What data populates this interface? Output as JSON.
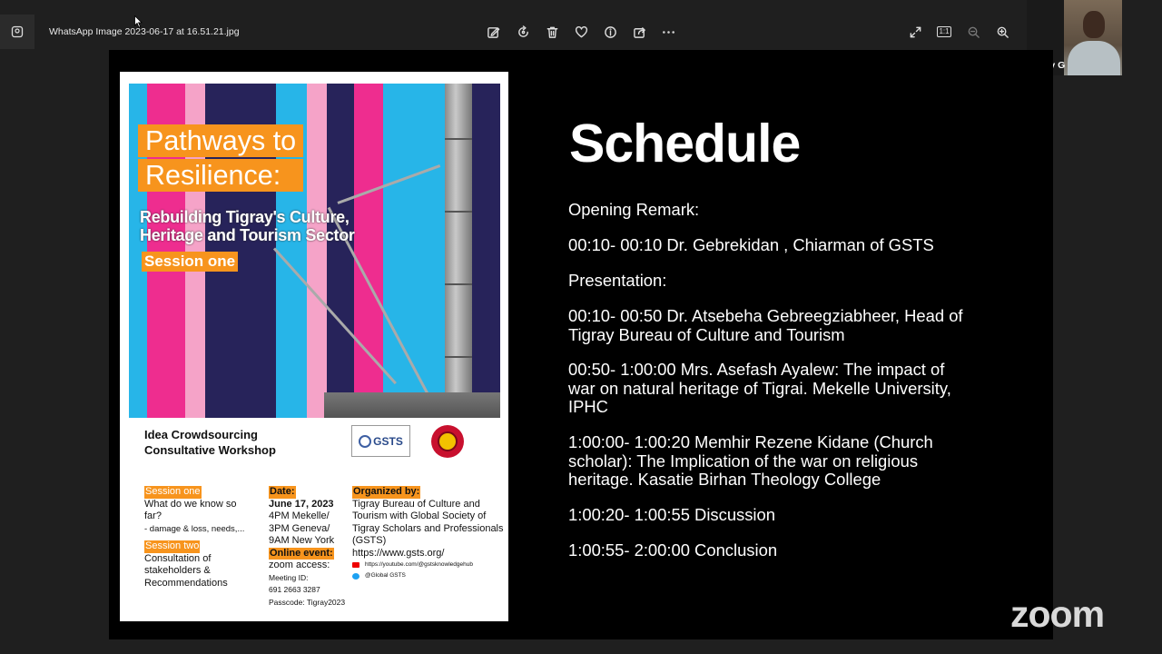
{
  "window": {
    "title": "WhatsApp Image 2023-06-17 at 16.51.21.jpg",
    "toolbar": [
      "edit-image-icon",
      "rotate-icon",
      "delete-icon",
      "favorite-icon",
      "info-icon",
      "share-icon",
      "more-icon"
    ],
    "right_tools": [
      "fullscreen-icon",
      "actual-size-icon",
      "zoom-out-icon",
      "zoom-in-icon"
    ],
    "actual_size_label": "1:1"
  },
  "participant": {
    "name": "Gidey G"
  },
  "poster": {
    "title_line1": "Pathways to",
    "title_line2": "Resilience:",
    "subtitle": "Rebuilding Tigray's Culture, Heritage and Tourism Sector",
    "session": "Session one",
    "workshop": "Idea Crowdsourcing Consultative Workshop",
    "logo_text": "GSTS",
    "col1": {
      "session_one": "Session one",
      "q1": "What do we know so far?",
      "q1_detail": "- damage & loss, needs,...",
      "session_two": "Session two",
      "q2": "Consultation of stakeholders & Recommendations"
    },
    "col2": {
      "date_label": "Date:",
      "date": "June 17, 2023",
      "t1": "4PM Mekelle/",
      "t2": "3PM Geneva/",
      "t3": "9AM New York",
      "online_label": "Online event:",
      "zoom": "zoom access:",
      "meeting_id_label": "Meeting ID:",
      "meeting_id": "691 2663 3287",
      "passcode": "Passcode: Tigray2023"
    },
    "col3": {
      "org_label": "Organized by:",
      "org": "Tigray Bureau of Culture and Tourism with Global Society of Tigray Scholars and Professionals (GSTS)",
      "url": "https://www.gsts.org/",
      "youtube": "https://youtube.com/@gstsknowledgehub",
      "twitter": "@Global GSTS"
    }
  },
  "schedule": {
    "title": "Schedule",
    "items": [
      "Opening Remark:",
      "00:10- 00:10 Dr. Gebrekidan , Chiarman of GSTS",
      "Presentation:",
      "00:10- 00:50 Dr. Atsebeha Gebreegziabheer, Head of Tigray Bureau of Culture and Tourism",
      "00:50- 1:00:00 Mrs. Asefash Ayalew: The impact of war on natural heritage of Tigrai. Mekelle University, IPHC",
      "1:00:00- 1:00:20 Memhir Rezene Kidane (Church scholar): The Implication of the war on religious heritage. Kasatie Birhan Theology College",
      "1:00:20- 1:00:55 Discussion",
      "1:00:55- 2:00:00  Conclusion"
    ]
  },
  "brand": {
    "zoom": "zoom"
  }
}
